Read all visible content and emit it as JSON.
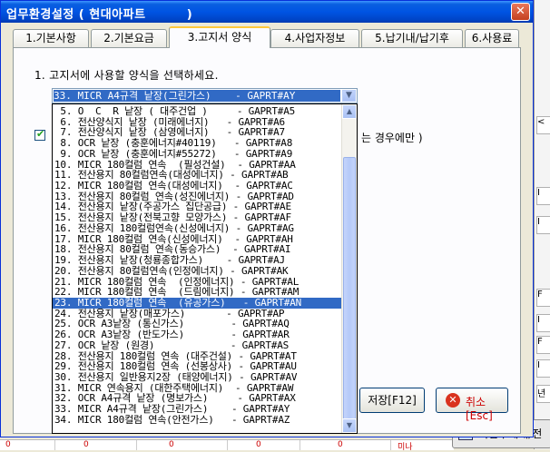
{
  "window": {
    "title": "업무환경설정 ( 현대아파트         )",
    "close_symbol": "✕"
  },
  "tabs": [
    {
      "label": "1.기본사항"
    },
    {
      "label": "2.기본요금"
    },
    {
      "label": "3.고지서 양식"
    },
    {
      "label": "4.사업자정보"
    },
    {
      "label": "5.납기내/납기후"
    },
    {
      "label": "6.사용료"
    }
  ],
  "active_tab": "3.고지서 양식",
  "form": {
    "question": "1. 고지서에 사용할 양식을 선택하세요.",
    "selected_value": "33. MICR A4규격 낱장(그린가스)    - GAPRT#AY",
    "checkbox_checked": true,
    "checkbox_note_visible": "는 경우에만 )"
  },
  "dropdown": {
    "highlighted_index": 18,
    "items": [
      " 5. O  C  R 낱장 ( 대주건업 )     - GAPRT#A5",
      " 6. 전산양식지 낱장 (미래에너지)   - GAPRT#A6",
      " 7. 전산양식지 낱장 (삼영에너지)   - GAPRT#A7",
      " 8. OCR 낱장 (충훈에너지#40119)   - GAPRT#A8",
      " 9. OCR 낱장 (충훈에너지#55272)   - GAPRT#A9",
      "10. MICR 180컬럼 연속  (필성건설)  - GAPRT#AA",
      "11. 전산용지 80컬럼연속(대성에너지) - GAPRT#AB",
      "12. MICR 180컬럼 연속(대성에너지)  - GAPRT#AC",
      "13. 전산용지 80컬럼 연속(성진에너지) - GAPRT#AD",
      "14. 전산용지 낱장(주공가스 집단공급) - GAPRT#AE",
      "15. 전산용지 낱장(전북고향 모양가스) - GAPRT#AF",
      "16. 전산용지 180컬럼연속(신성에너지) - GAPRT#AG",
      "17. MICR 180컬럼 연속(신성에너지)  - GAPRT#AH",
      "18. 전산용지 80컬럼 연속(동승가스)  - GAPRT#AI",
      "19. 전산용지 낱장(청룡종합가스)    - GAPRT#AJ",
      "20. 전산용지 80컬럼연속(인정에너지) - GAPRT#AK",
      "21. MICR 180컬럼 연속  (인정에너지) - GAPRT#AL",
      "22. MICR 180컬럼 연속  (드림에너지) - GAPRT#AM",
      "23. MICR 180컬럼 연속  (유공가스)   - GAPRT#AN",
      "24. 전산용지 낱장(매포가스)       - GAPRT#AP",
      "25. OCR A3낱장 (통신가스)        - GAPRT#AQ",
      "26. OCR A3낱장 (반도가스)        - GAPRT#AR",
      "27. OCR 낱장 (원경)             - GAPRT#AS",
      "28. 전산용지 180컬럼 연속 (대주건설) - GAPRT#AT",
      "29. 전산용지 180컬럼 연속 (선봉상사) - GAPRT#AU",
      "30. 전산용지 일반용지2장 (태양에너지) - GAPRT#AV",
      "31. MICR 연속용지 (대한주택에너지)  - GAPRT#AW",
      "32. OCR A4규격 낱장 (명보가스)     - GAPRT#AX",
      "33. MICR A4규격 낱장(그린가스)    - GAPRT#AY",
      "34. MICR 180컬럼 연속(안전가스)   - GAPRT#AZ"
    ]
  },
  "buttons": {
    "save": "저장[F12]",
    "cancel": "취소[Esc]"
  },
  "background_window": {
    "button_label": "미입주세대/전",
    "right_edge_chars": [
      "<",
      "I",
      "I",
      "F",
      "I",
      "F",
      "I",
      "년",
      "전"
    ],
    "bottom_chars": [
      "0",
      "0",
      "0",
      "0",
      "0",
      "미나"
    ]
  },
  "colors": {
    "title_blue": "#0054e3",
    "selection_blue": "#316ac5",
    "tab_active_accent": "#ffc83c",
    "cancel_red": "#d9321e"
  }
}
